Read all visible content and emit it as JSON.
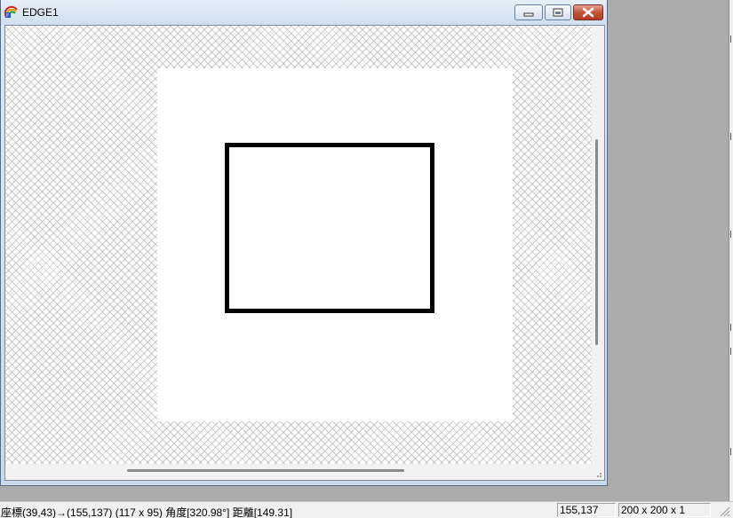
{
  "window": {
    "title": "EDGE1",
    "icon": "palette-icon",
    "controls": {
      "minimize_icon": "minimize-icon",
      "restore_icon": "restore-icon",
      "close_icon": "close-icon"
    }
  },
  "canvas": {
    "shape": "rectangle"
  },
  "statusbar": {
    "info": "座標(39,43)→(155,137)  (117 x 95)  角度[320.98°]  距離[149.31]",
    "cursor_position": "155,137",
    "image_size": "200 x 200 x 1"
  },
  "colors": {
    "close_button": "#c6533a",
    "title_gradient_top": "#e6eff9",
    "desktop": "#ababab"
  }
}
